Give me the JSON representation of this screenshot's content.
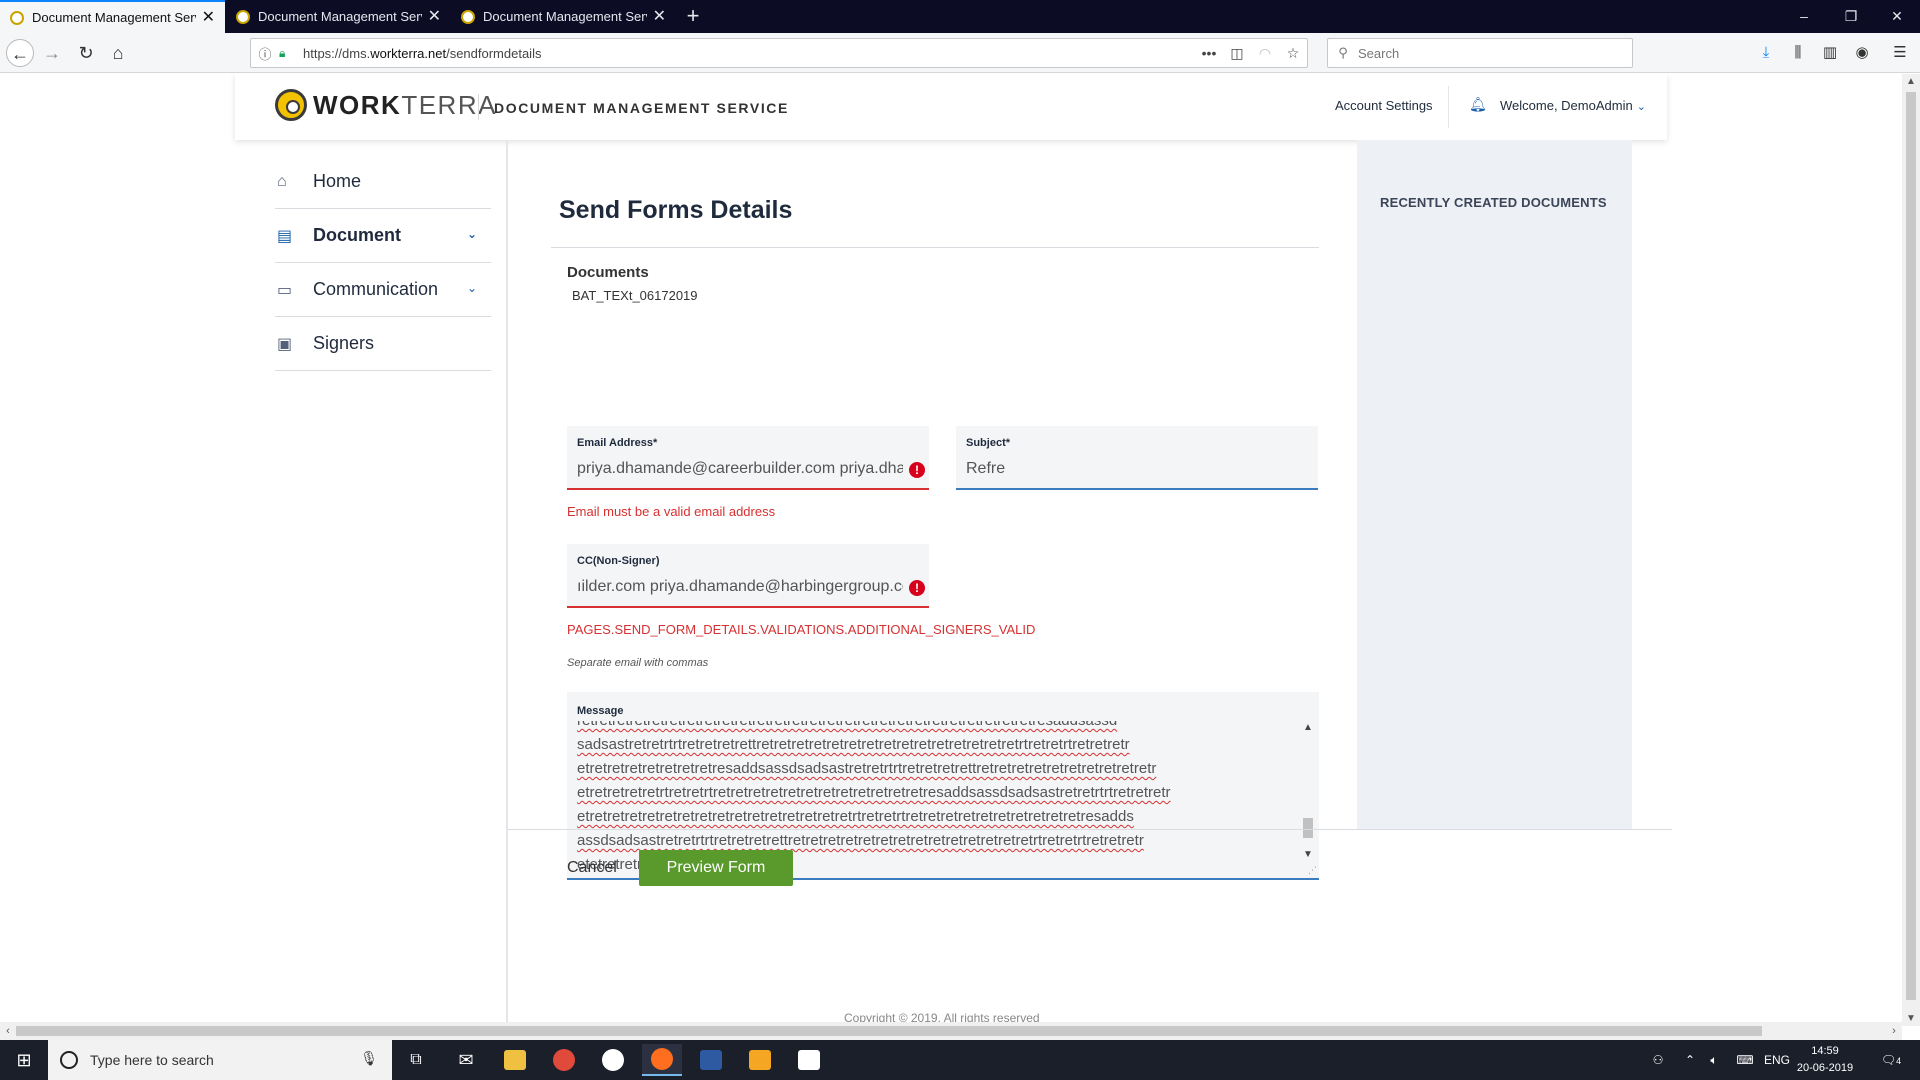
{
  "browser": {
    "tabs": [
      {
        "title": "Document Management Servic",
        "active": true
      },
      {
        "title": "Document Management Servic",
        "active": false
      },
      {
        "title": "Document Management Servic",
        "active": false
      }
    ],
    "url_prefix": "https://dms.",
    "url_host": "workterra.net",
    "url_path": "/sendformdetails",
    "search_placeholder": "Search",
    "window_controls": {
      "minimize": "–",
      "restore": "❐",
      "close": "✕"
    }
  },
  "header": {
    "logo_bold": "WORK",
    "logo_light": "TERRA",
    "service_title": "DOCUMENT MANAGEMENT SERVICE",
    "account_settings": "Account Settings",
    "welcome": "Welcome, DemoAdmin"
  },
  "sidebar": {
    "items": [
      {
        "label": "Home",
        "icon": "home-icon",
        "has_chevron": false
      },
      {
        "label": "Document",
        "icon": "document-icon",
        "has_chevron": true,
        "active": true
      },
      {
        "label": "Communication",
        "icon": "chat-icon",
        "has_chevron": true
      },
      {
        "label": "Signers",
        "icon": "signer-badge-icon",
        "has_chevron": false
      }
    ]
  },
  "main": {
    "title": "Send Forms Details",
    "documents_label": "Documents",
    "documents_value": "BAT_TEXt_06172019",
    "email": {
      "label": "Email Address*",
      "value": "priya.dhamande@careerbuilder.com priya.dham",
      "error": "Email must be a valid email address"
    },
    "subject": {
      "label": "Subject*",
      "value": "Refre"
    },
    "cc": {
      "label": "CC(Non-Signer)",
      "value": "ıilder.com priya.dhamande@harbingergroup.com",
      "error": "PAGES.SEND_FORM_DETAILS.VALIDATIONS.ADDITIONAL_SIGNERS_VALID",
      "hint": "Separate email with commas"
    },
    "message": {
      "label": "Message",
      "lines": [
        "retretretretretretretretretretretretretretretretretretretretretretretretretretresaddsassd",
        "sadsastretretrtrtretretretrettretretretretretretretretretretretretretretretrtretretrtretretretr",
        "etretretretretretretretresaddsassdsadsastretretrtrtretretretrettretretretretretretretretretretr",
        "etretretretretrtretretrtretretretretretretretretretretretretresaddsassdsadsastretretrtrtretretretr",
        "etretretretretretretretretretretretretretretretrtretretrtretretretretretretretretretretresadds",
        "assdsadsastretretrtrtretretretrettretretretretretretretretretretretretretretrtretretrtretretretr",
        "etetretretretretretretretre"
      ]
    },
    "cancel_label": "Cancel",
    "preview_label": "Preview Form"
  },
  "right_panel": {
    "title": "RECENTLY CREATED DOCUMENTS"
  },
  "footer": {
    "copyright": "Copyright © 2019. All rights reserved"
  },
  "taskbar": {
    "search_placeholder": "Type here to search",
    "language": "ENG",
    "time": "14:59",
    "date": "20-06-2019",
    "notification_count": "4"
  },
  "colors": {
    "primary_blue": "#1a5ea8",
    "error_red": "#d63031",
    "preview_green": "#5a9a2d",
    "panel_bg": "#edf0f4"
  }
}
